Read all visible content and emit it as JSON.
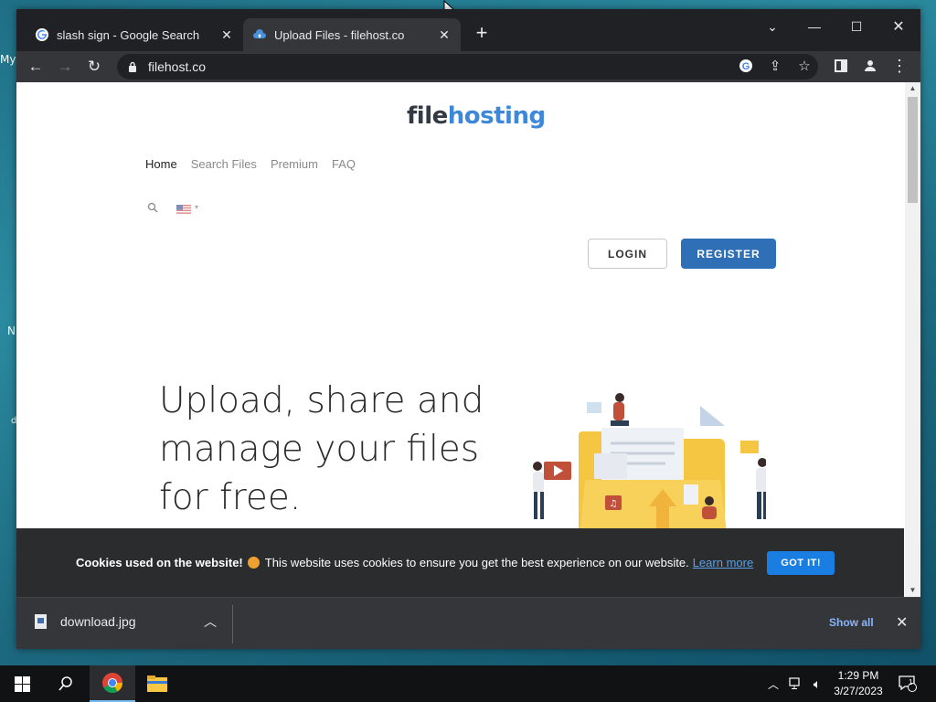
{
  "desktop": {
    "fragments": [
      "My",
      "N",
      "d"
    ]
  },
  "browser": {
    "tabs": [
      {
        "title": "slash sign - Google Search",
        "favicon": "google-icon",
        "active": false
      },
      {
        "title": "Upload Files - filehost.co",
        "favicon": "cloud-upload-icon",
        "active": true
      }
    ],
    "url": "filehost.co"
  },
  "page": {
    "logo_part1": "file",
    "logo_part2": "hosting",
    "nav": [
      "Home",
      "Search Files",
      "Premium",
      "FAQ"
    ],
    "login_label": "LOGIN",
    "register_label": "REGISTER",
    "hero_lines": [
      "Upload, share and",
      "manage your files",
      "for free."
    ],
    "cookie": {
      "bold": "Cookies used on the website!",
      "text": "This website uses cookies to ensure you get the best experience on our website.",
      "learn_more": "Learn more",
      "button": "GOT IT!"
    }
  },
  "downloads": {
    "file_name": "download.jpg",
    "show_all": "Show all"
  },
  "taskbar": {
    "time": "1:29 PM",
    "date": "3/27/2023",
    "notification_count": "1"
  },
  "colors": {
    "accent": "#2f6fb5",
    "logo_blue": "#3d88d8",
    "cookie_button": "#1a7de2",
    "show_all": "#8ab4f8"
  }
}
